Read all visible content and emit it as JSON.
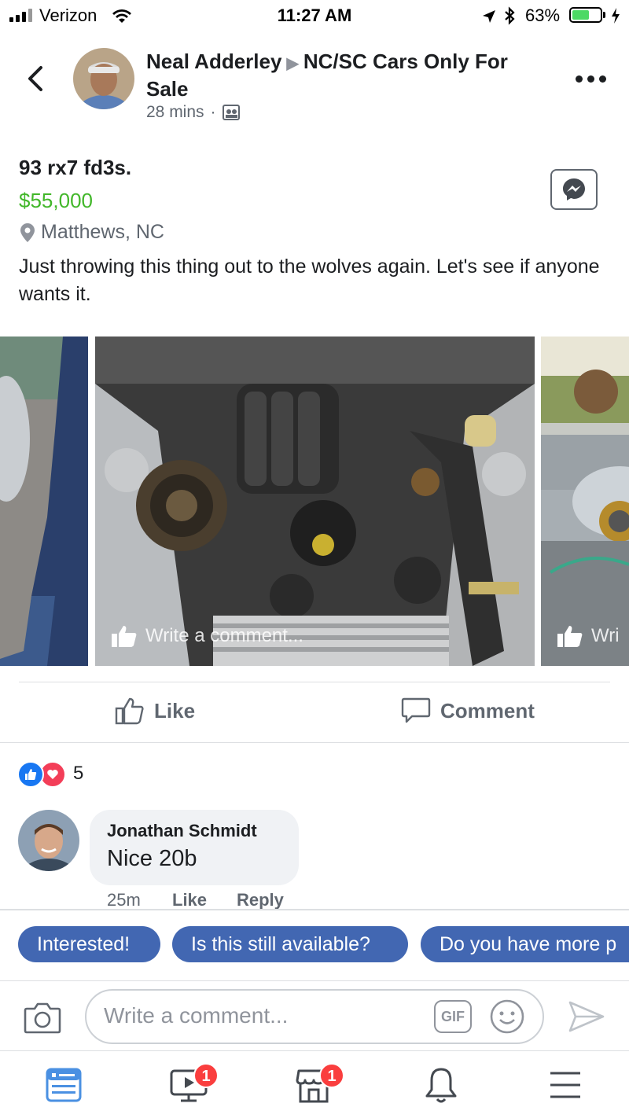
{
  "status_bar": {
    "carrier": "Verizon",
    "time": "11:27 AM",
    "battery_percent": "63%",
    "battery_level": 0.63
  },
  "header": {
    "author": "Neal Adderley",
    "group": "NC/SC Cars Only For Sale",
    "time_ago": "28 mins",
    "separator": "·"
  },
  "post": {
    "title": "93 rx7 fd3s.",
    "price": "$55,000",
    "location": "Matthews, NC",
    "body": "Just throwing this thing out to the wolves again. Let's see if anyone wants it."
  },
  "photos": {
    "overlay_comment": "Write a comment...",
    "overlay_comment_partial": "Wri"
  },
  "actions": {
    "like": "Like",
    "comment": "Comment"
  },
  "reactions": {
    "count": "5",
    "types": [
      "like",
      "love"
    ]
  },
  "comments": [
    {
      "author": "Jonathan Schmidt",
      "text": "Nice 20b",
      "time": "25m",
      "like": "Like",
      "reply": "Reply"
    }
  ],
  "quick_replies": [
    "Interested!",
    "Is this still available?",
    "Do you have more p"
  ],
  "composer": {
    "placeholder": "Write a comment...",
    "gif": "GIF"
  },
  "bottom_nav": {
    "items": [
      {
        "name": "news-feed",
        "badge": ""
      },
      {
        "name": "watch",
        "badge": "1"
      },
      {
        "name": "marketplace",
        "badge": "1"
      },
      {
        "name": "notifications",
        "badge": ""
      },
      {
        "name": "menu",
        "badge": ""
      }
    ]
  },
  "colors": {
    "accent": "#4267b2",
    "price": "#42b72a",
    "badge": "#fa3e3e",
    "nav_active": "#4a90e2"
  }
}
